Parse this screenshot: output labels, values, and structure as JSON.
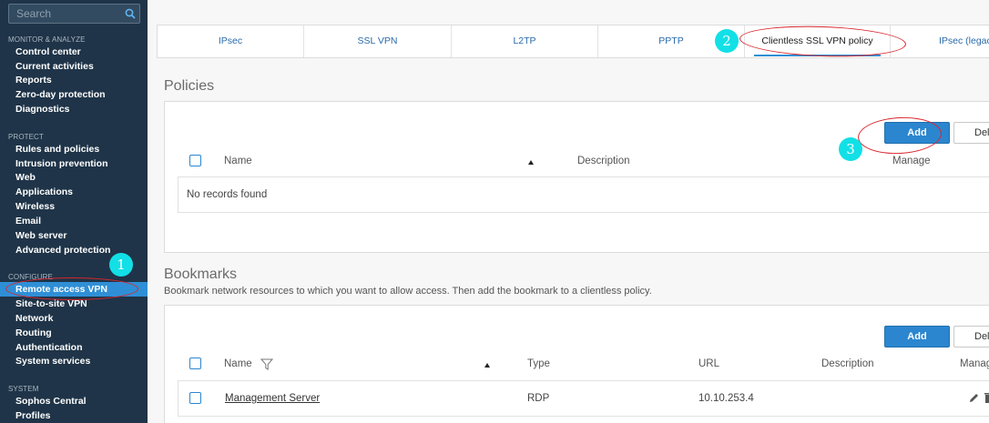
{
  "sidebar": {
    "search_placeholder": "Search",
    "sections": [
      {
        "title": "MONITOR & ANALYZE",
        "items": [
          "Control center",
          "Current activities",
          "Reports",
          "Zero-day protection",
          "Diagnostics"
        ]
      },
      {
        "title": "PROTECT",
        "items": [
          "Rules and policies",
          "Intrusion prevention",
          "Web",
          "Applications",
          "Wireless",
          "Email",
          "Web server",
          "Advanced protection"
        ]
      },
      {
        "title": "CONFIGURE",
        "items": [
          "Remote access VPN",
          "Site-to-site VPN",
          "Network",
          "Routing",
          "Authentication",
          "System services"
        ]
      },
      {
        "title": "SYSTEM",
        "items": [
          "Sophos Central",
          "Profiles"
        ]
      }
    ],
    "active_item": "Remote access VPN"
  },
  "tabs": [
    "IPsec",
    "SSL VPN",
    "L2TP",
    "PPTP",
    "Clientless SSL VPN policy",
    "IPsec (legacy)"
  ],
  "active_tab": "Clientless SSL VPN policy",
  "policies": {
    "title": "Policies",
    "add_label": "Add",
    "delete_label": "Delete",
    "columns": {
      "name": "Name",
      "description": "Description",
      "manage": "Manage"
    },
    "empty_text": "No records found"
  },
  "bookmarks": {
    "title": "Bookmarks",
    "subtitle": "Bookmark network resources to which you want to allow access. Then add the bookmark to a clientless policy.",
    "add_label": "Add",
    "delete_label": "Delete",
    "columns": {
      "name": "Name",
      "type": "Type",
      "url": "URL",
      "description": "Description",
      "manage": "Manage"
    },
    "rows": [
      {
        "name": "Management Server",
        "type": "RDP",
        "url": "10.10.253.4",
        "description": ""
      }
    ]
  },
  "annotations": {
    "step1": "1",
    "step2": "2",
    "step3": "3",
    "color": "#d9262c",
    "badge_color": "#12e0e6"
  }
}
